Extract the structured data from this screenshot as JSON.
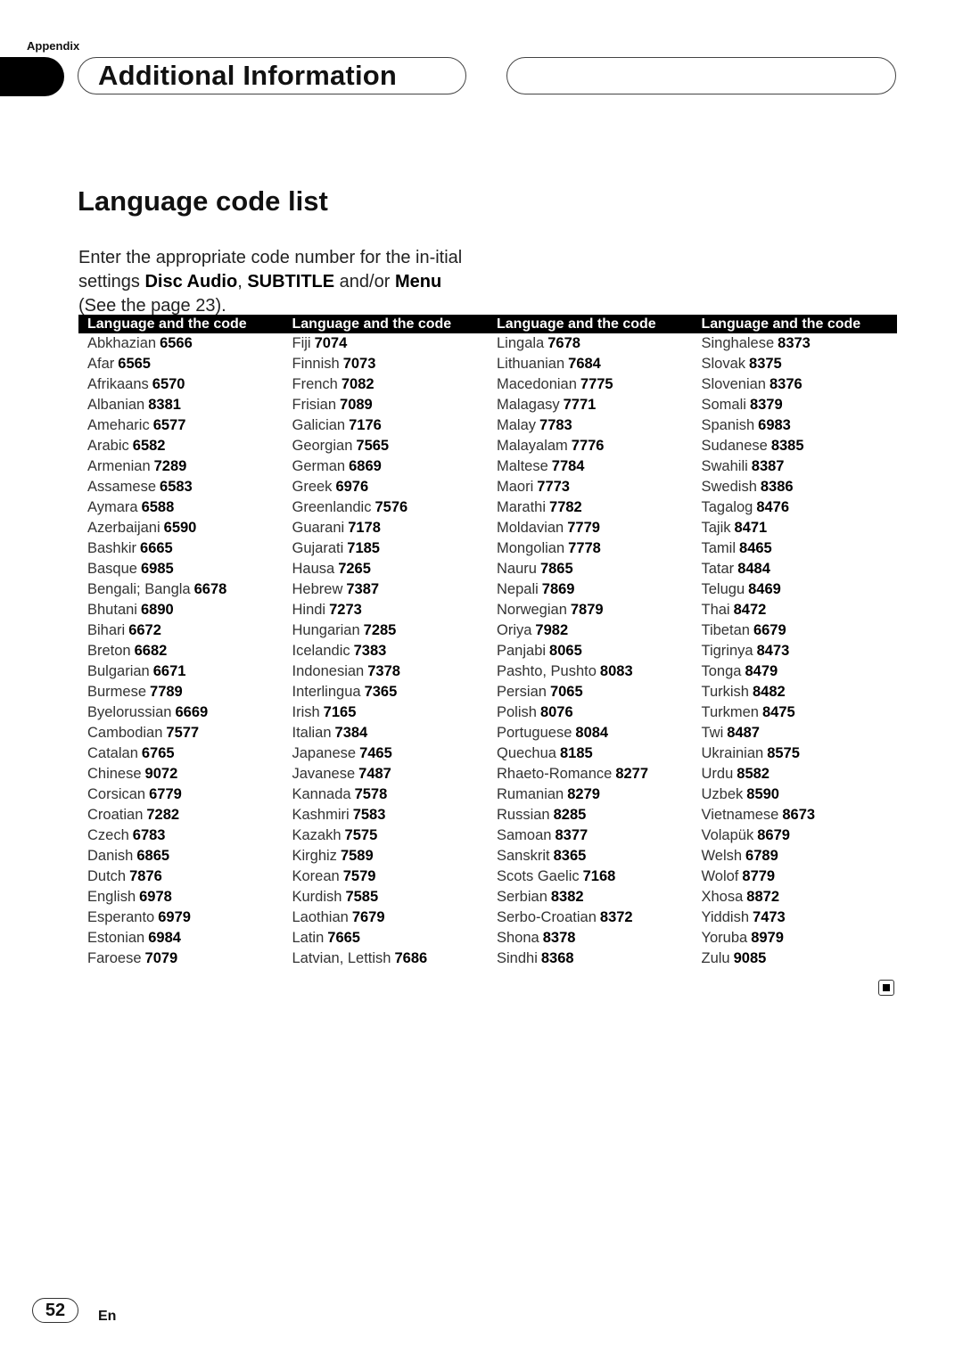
{
  "header": {
    "appendix": "Appendix",
    "section_title": "Additional Information"
  },
  "page": {
    "title": "Language code list",
    "intro": {
      "text1": "Enter the appropriate code number for the in-itial settings ",
      "bold1": "Disc Audio",
      "sep": ", ",
      "bold2": "SUBTITLE",
      "text2": " and/or ",
      "bold3": "Menu",
      "text3": " (See the page 23)."
    },
    "column_header": "Language and the code",
    "columns": [
      [
        {
          "name": "Abkhazian",
          "code": "6566"
        },
        {
          "name": "Afar",
          "code": "6565"
        },
        {
          "name": "Afrikaans",
          "code": "6570"
        },
        {
          "name": "Albanian",
          "code": "8381"
        },
        {
          "name": "Ameharic",
          "code": "6577"
        },
        {
          "name": "Arabic",
          "code": "6582"
        },
        {
          "name": "Armenian",
          "code": "7289"
        },
        {
          "name": "Assamese",
          "code": "6583"
        },
        {
          "name": "Aymara",
          "code": "6588"
        },
        {
          "name": "Azerbaijani",
          "code": "6590"
        },
        {
          "name": "Bashkir",
          "code": "6665"
        },
        {
          "name": "Basque",
          "code": "6985"
        },
        {
          "name": "Bengali; Bangla",
          "code": "6678"
        },
        {
          "name": "Bhutani",
          "code": "6890"
        },
        {
          "name": "Bihari",
          "code": "6672"
        },
        {
          "name": "Breton",
          "code": "6682"
        },
        {
          "name": "Bulgarian",
          "code": "6671"
        },
        {
          "name": "Burmese",
          "code": "7789"
        },
        {
          "name": "Byelorussian",
          "code": "6669"
        },
        {
          "name": "Cambodian",
          "code": "7577"
        },
        {
          "name": "Catalan",
          "code": "6765"
        },
        {
          "name": "Chinese",
          "code": "9072"
        },
        {
          "name": "Corsican",
          "code": "6779"
        },
        {
          "name": "Croatian",
          "code": "7282"
        },
        {
          "name": "Czech",
          "code": "6783"
        },
        {
          "name": "Danish",
          "code": "6865"
        },
        {
          "name": "Dutch",
          "code": "7876"
        },
        {
          "name": "English",
          "code": "6978"
        },
        {
          "name": "Esperanto",
          "code": "6979"
        },
        {
          "name": "Estonian",
          "code": "6984"
        },
        {
          "name": "Faroese",
          "code": "7079"
        }
      ],
      [
        {
          "name": "Fiji",
          "code": "7074"
        },
        {
          "name": "Finnish",
          "code": "7073"
        },
        {
          "name": "French",
          "code": "7082"
        },
        {
          "name": "Frisian",
          "code": "7089"
        },
        {
          "name": "Galician",
          "code": "7176"
        },
        {
          "name": "Georgian",
          "code": "7565"
        },
        {
          "name": "German",
          "code": "6869"
        },
        {
          "name": "Greek",
          "code": "6976"
        },
        {
          "name": "Greenlandic",
          "code": "7576"
        },
        {
          "name": "Guarani",
          "code": "7178"
        },
        {
          "name": "Gujarati",
          "code": "7185"
        },
        {
          "name": "Hausa",
          "code": "7265"
        },
        {
          "name": "Hebrew",
          "code": "7387"
        },
        {
          "name": "Hindi",
          "code": "7273"
        },
        {
          "name": "Hungarian",
          "code": "7285"
        },
        {
          "name": "Icelandic",
          "code": "7383"
        },
        {
          "name": "Indonesian",
          "code": "7378"
        },
        {
          "name": "Interlingua",
          "code": "7365"
        },
        {
          "name": "Irish",
          "code": "7165"
        },
        {
          "name": "Italian",
          "code": "7384"
        },
        {
          "name": "Japanese",
          "code": "7465"
        },
        {
          "name": "Javanese",
          "code": "7487"
        },
        {
          "name": "Kannada",
          "code": "7578"
        },
        {
          "name": "Kashmiri",
          "code": "7583"
        },
        {
          "name": "Kazakh",
          "code": "7575"
        },
        {
          "name": "Kirghiz",
          "code": "7589"
        },
        {
          "name": "Korean",
          "code": "7579"
        },
        {
          "name": "Kurdish",
          "code": "7585"
        },
        {
          "name": "Laothian",
          "code": "7679"
        },
        {
          "name": "Latin",
          "code": "7665"
        },
        {
          "name": "Latvian, Lettish",
          "code": "7686"
        }
      ],
      [
        {
          "name": "Lingala",
          "code": "7678"
        },
        {
          "name": "Lithuanian",
          "code": "7684"
        },
        {
          "name": "Macedonian",
          "code": "7775"
        },
        {
          "name": "Malagasy",
          "code": "7771"
        },
        {
          "name": "Malay",
          "code": "7783"
        },
        {
          "name": "Malayalam",
          "code": "7776"
        },
        {
          "name": "Maltese",
          "code": "7784"
        },
        {
          "name": "Maori",
          "code": "7773"
        },
        {
          "name": "Marathi",
          "code": "7782"
        },
        {
          "name": "Moldavian",
          "code": "7779"
        },
        {
          "name": "Mongolian",
          "code": "7778"
        },
        {
          "name": "Nauru",
          "code": "7865"
        },
        {
          "name": "Nepali",
          "code": "7869"
        },
        {
          "name": "Norwegian",
          "code": "7879"
        },
        {
          "name": "Oriya",
          "code": "7982"
        },
        {
          "name": "Panjabi",
          "code": "8065"
        },
        {
          "name": "Pashto, Pushto",
          "code": "8083"
        },
        {
          "name": "Persian",
          "code": "7065"
        },
        {
          "name": "Polish",
          "code": "8076"
        },
        {
          "name": "Portuguese",
          "code": "8084"
        },
        {
          "name": "Quechua",
          "code": "8185"
        },
        {
          "name": "Rhaeto-Romance",
          "code": "8277"
        },
        {
          "name": "Rumanian",
          "code": "8279"
        },
        {
          "name": "Russian",
          "code": "8285"
        },
        {
          "name": "Samoan",
          "code": "8377"
        },
        {
          "name": "Sanskrit",
          "code": "8365"
        },
        {
          "name": "Scots Gaelic",
          "code": "7168"
        },
        {
          "name": "Serbian",
          "code": "8382"
        },
        {
          "name": "Serbo-Croatian",
          "code": "8372"
        },
        {
          "name": "Shona",
          "code": "8378"
        },
        {
          "name": "Sindhi",
          "code": "8368"
        }
      ],
      [
        {
          "name": "Singhalese",
          "code": "8373"
        },
        {
          "name": "Slovak",
          "code": "8375"
        },
        {
          "name": "Slovenian",
          "code": "8376"
        },
        {
          "name": "Somali",
          "code": "8379"
        },
        {
          "name": "Spanish",
          "code": "6983"
        },
        {
          "name": "Sudanese",
          "code": "8385"
        },
        {
          "name": "Swahili",
          "code": "8387"
        },
        {
          "name": "Swedish",
          "code": "8386"
        },
        {
          "name": "Tagalog",
          "code": "8476"
        },
        {
          "name": "Tajik",
          "code": "8471"
        },
        {
          "name": "Tamil",
          "code": "8465"
        },
        {
          "name": "Tatar",
          "code": "8484"
        },
        {
          "name": "Telugu",
          "code": "8469"
        },
        {
          "name": "Thai",
          "code": "8472"
        },
        {
          "name": "Tibetan",
          "code": "6679"
        },
        {
          "name": "Tigrinya",
          "code": "8473"
        },
        {
          "name": "Tonga",
          "code": "8479"
        },
        {
          "name": "Turkish",
          "code": "8482"
        },
        {
          "name": "Turkmen",
          "code": "8475"
        },
        {
          "name": "Twi",
          "code": "8487"
        },
        {
          "name": "Ukrainian",
          "code": "8575"
        },
        {
          "name": "Urdu",
          "code": "8582"
        },
        {
          "name": "Uzbek",
          "code": "8590"
        },
        {
          "name": "Vietnamese",
          "code": "8673"
        },
        {
          "name": "Volapük",
          "code": "8679"
        },
        {
          "name": "Welsh",
          "code": "6789"
        },
        {
          "name": "Wolof",
          "code": "8779"
        },
        {
          "name": "Xhosa",
          "code": "8872"
        },
        {
          "name": "Yiddish",
          "code": "7473"
        },
        {
          "name": "Yoruba",
          "code": "8979"
        },
        {
          "name": "Zulu",
          "code": "9085"
        }
      ]
    ],
    "end_mark_icon": "end-of-section-icon"
  },
  "footer": {
    "page_number": "52",
    "language": "En"
  }
}
